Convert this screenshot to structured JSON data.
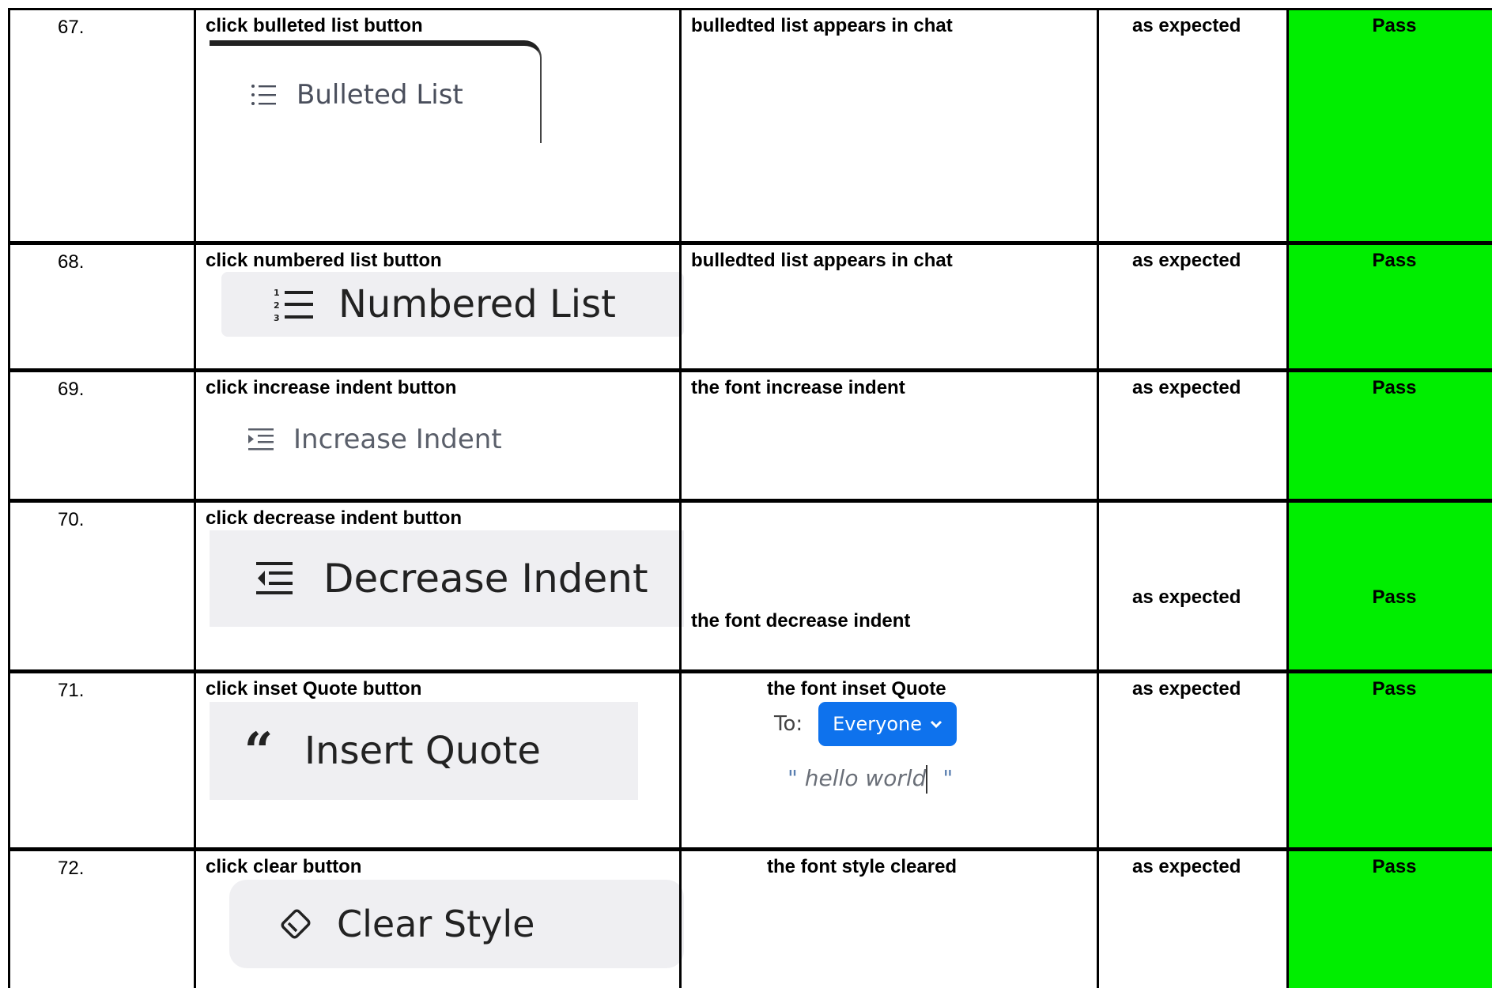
{
  "rows": [
    {
      "num": "67.",
      "step": "click bulleted list button",
      "expected": "bulledted list appears in chat",
      "actual": "as expected",
      "status": "Pass",
      "screenshot": {
        "label": "Bulleted List",
        "icon": "bulleted-list-icon"
      }
    },
    {
      "num": "68.",
      "step": "click numbered list button",
      "expected": "bulledted list appears in chat",
      "actual": "as expected",
      "status": "Pass",
      "screenshot": {
        "label": "Numbered List",
        "icon": "numbered-list-icon"
      }
    },
    {
      "num": "69.",
      "step": "click increase indent button",
      "expected": "the font increase indent",
      "actual": "as expected",
      "status": "Pass",
      "screenshot": {
        "label": "Increase Indent",
        "icon": "increase-indent-icon"
      }
    },
    {
      "num": "70.",
      "step": "click decrease indent button",
      "expected": "the font decrease indent",
      "actual": "as expected",
      "status": "Pass",
      "screenshot": {
        "label": "Decrease Indent",
        "icon": "decrease-indent-icon"
      }
    },
    {
      "num": "71.",
      "step": "click inset Quote  button",
      "expected": "the font inset Quote",
      "actual": "as expected",
      "status": "Pass",
      "screenshot": {
        "label": "Insert Quote",
        "icon": "quote-icon",
        "glyph": "“"
      },
      "chat": {
        "to_label": "To:",
        "recipient": "Everyone",
        "open_quote": "\"",
        "message": "hello world",
        "close_quote": "\""
      }
    },
    {
      "num": "72.",
      "step": "click clear  button",
      "expected": "the font style cleared",
      "actual": "as expected",
      "status": "Pass",
      "screenshot": {
        "label": "Clear Style",
        "icon": "eraser-icon"
      }
    }
  ],
  "colors": {
    "pass": "#00ee00",
    "recipient_button": "#0e72ed"
  }
}
